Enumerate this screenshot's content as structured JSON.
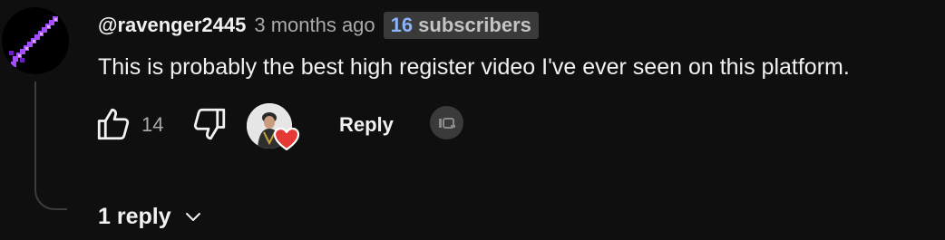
{
  "comment": {
    "author": "@ravenger2445",
    "time": "3 months ago",
    "badge": {
      "count": "16",
      "label": "subscribers",
      "count_color": "#8ab4f8"
    },
    "text": "This is probably the best high register video I've ever seen on this platform.",
    "like_count": "14",
    "reply_label": "Reply",
    "icons": {
      "avatar": "purple-pixel-sword-avatar",
      "like": "thumbs-up-icon",
      "dislike": "thumbs-down-icon",
      "creator_heart": "creator-heart-icon",
      "extension": "extension-badge-icon",
      "expand": "chevron-down-icon"
    }
  },
  "replies": {
    "label": "1 reply"
  },
  "colors": {
    "background": "#0f0f0f",
    "text_primary": "#f1f1f1",
    "text_secondary": "#aaaaaa",
    "heart": "#e53935",
    "avatar_accent": "#a64dff"
  }
}
